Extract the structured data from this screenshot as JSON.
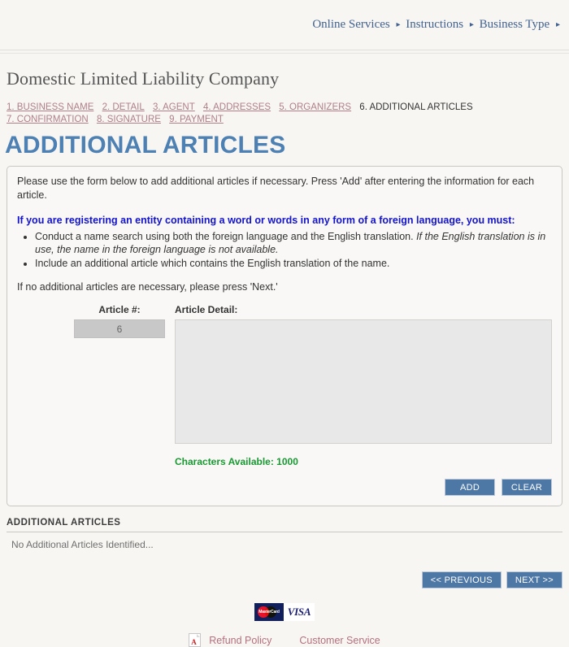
{
  "breadcrumb": {
    "items": [
      {
        "label": "Online Services"
      },
      {
        "label": "Instructions"
      },
      {
        "label": "Business Type"
      }
    ],
    "separator": "▸"
  },
  "page": {
    "title": "Domestic Limited Liability Company",
    "heading": "ADDITIONAL ARTICLES"
  },
  "steps": [
    {
      "label": "1. BUSINESS NAME",
      "current": false
    },
    {
      "label": "2. DETAIL",
      "current": false
    },
    {
      "label": "3. AGENT",
      "current": false
    },
    {
      "label": "4. ADDRESSES",
      "current": false
    },
    {
      "label": "5. ORGANIZERS",
      "current": false
    },
    {
      "label": "6. ADDITIONAL ARTICLES",
      "current": true
    },
    {
      "label": "7. CONFIRMATION",
      "current": false
    },
    {
      "label": "8. SIGNATURE",
      "current": false
    },
    {
      "label": "9. PAYMENT",
      "current": false
    }
  ],
  "instructions": {
    "intro": "Please use the form below to add additional articles if necessary. Press 'Add' after entering the information for each article.",
    "warning_heading": "If you are registering an entity containing a word or words in any form of a foreign language, you must:",
    "bullets": [
      {
        "text_plain": "Conduct a name search using both the foreign language and the English translation. ",
        "text_italic": "If the English translation is in use, the name in the foreign language is not available."
      },
      {
        "text_plain": "Include an additional article which contains the English translation of the name.",
        "text_italic": ""
      }
    ],
    "note": "If no additional articles are necessary, please press 'Next.'"
  },
  "form": {
    "article_number_label": "Article #:",
    "article_number_value": "6",
    "article_detail_label": "Article Detail:",
    "article_detail_value": "",
    "article_detail_placeholder": "",
    "characters_available": "Characters Available: 1000",
    "add_label": "ADD",
    "clear_label": "CLEAR"
  },
  "results": {
    "section_title": "ADDITIONAL ARTICLES",
    "empty_message": "No Additional Articles Identified..."
  },
  "navigation": {
    "previous_label": "<< PREVIOUS",
    "next_label": "NEXT >>"
  },
  "footer": {
    "cards": [
      {
        "name": "mastercard",
        "text": "MasterCard"
      },
      {
        "name": "visa",
        "text": "VISA"
      }
    ],
    "links": [
      {
        "label": "Refund Policy",
        "icon": "pdf-icon"
      },
      {
        "label": "Customer Service",
        "icon": ""
      }
    ]
  },
  "colors": {
    "accent_blue": "#4d80b3",
    "button_blue": "#4d77a5",
    "link_rose": "#b07f88",
    "warning_blue": "#1414cc",
    "success_green": "#1a9933",
    "page_bg": "#f7f6f3"
  }
}
